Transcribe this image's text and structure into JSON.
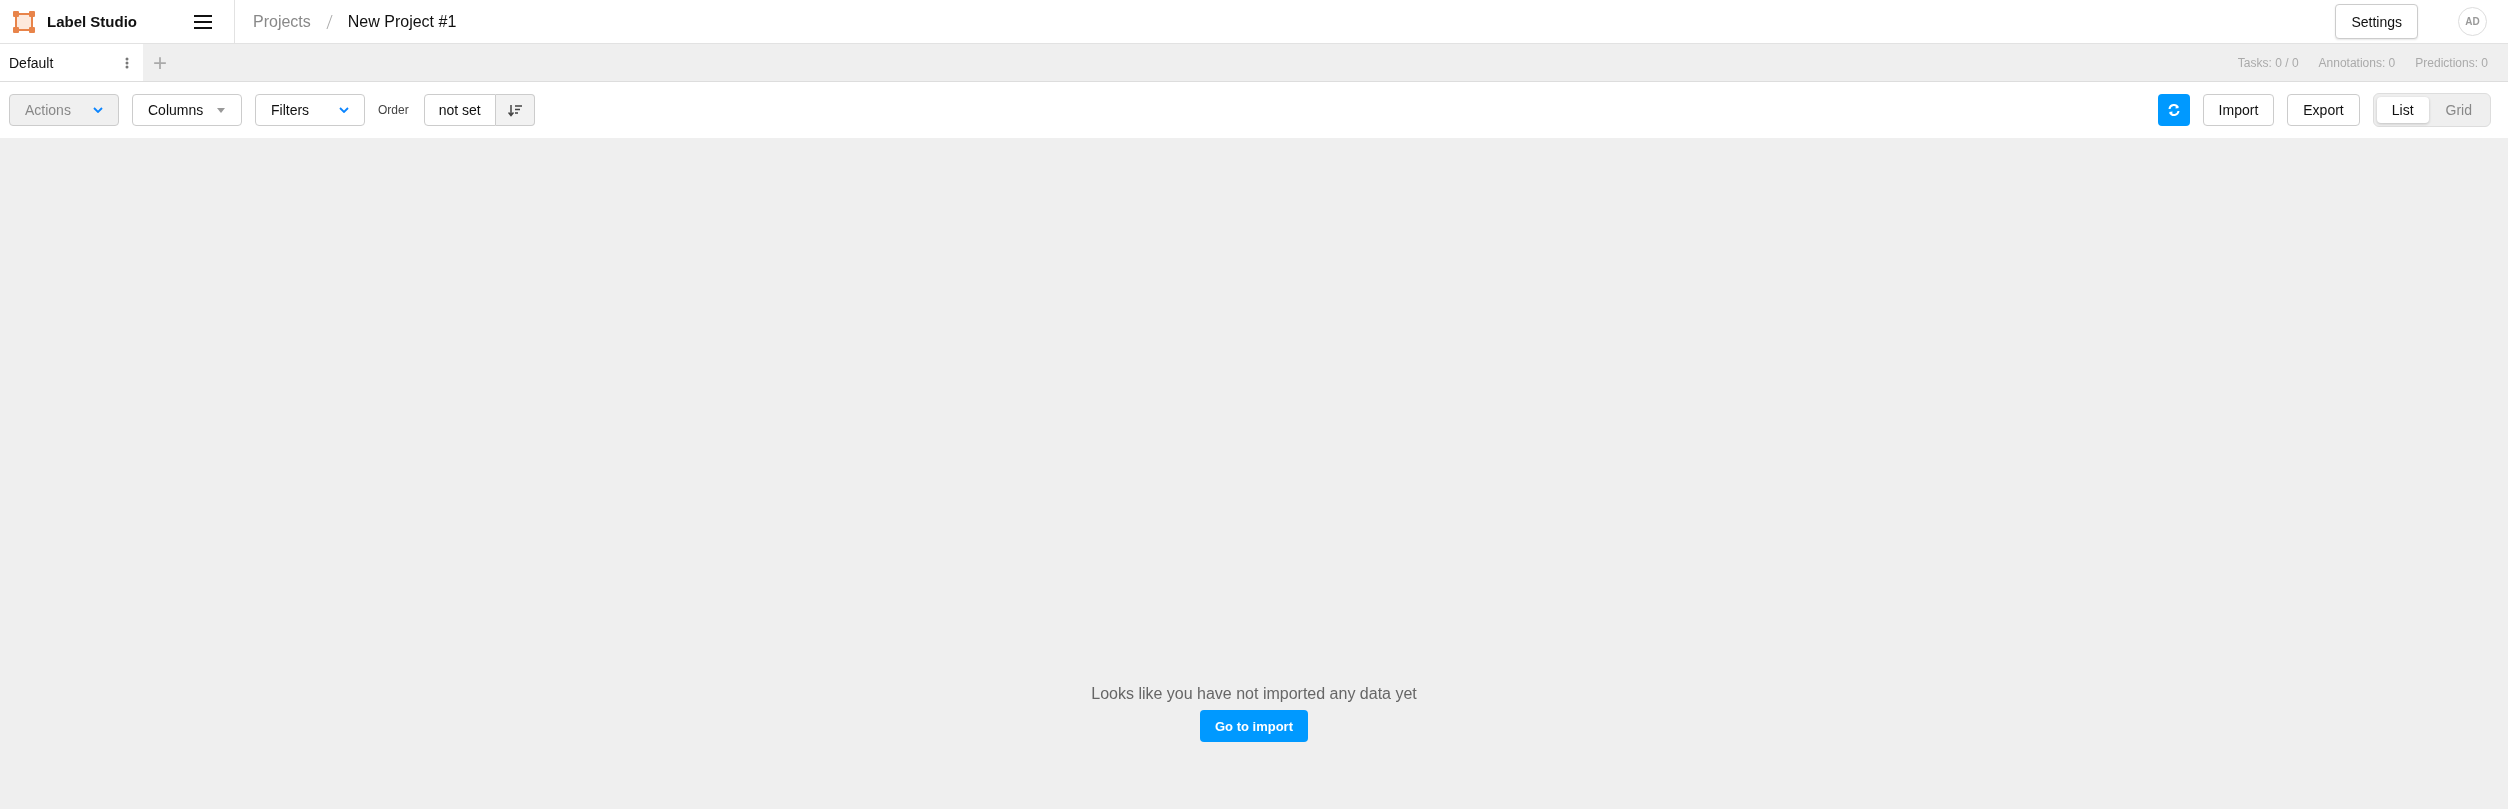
{
  "header": {
    "app_name": "Label Studio",
    "breadcrumbs": [
      "Projects",
      "New Project #1"
    ],
    "settings_button": "Settings",
    "avatar": "AD"
  },
  "tabs": [
    {
      "label": "Default",
      "selected": true
    }
  ],
  "add_tab": "+",
  "stats": [
    "Tasks: 0 / 0",
    "Annotations: 0",
    "Predictions: 0"
  ],
  "toolbar": {
    "actions": {
      "label": "Actions",
      "disabled": true
    },
    "columns": "Columns",
    "filters": "Filters",
    "order_label": "Order",
    "order_value": "not set",
    "import": "Import",
    "export": "Export",
    "views": [
      {
        "label": "List",
        "selected": true
      },
      {
        "label": "Grid",
        "selected": false
      }
    ]
  },
  "empty": {
    "message": "Looks like you have not imported any data yet",
    "button": "Go to import"
  }
}
